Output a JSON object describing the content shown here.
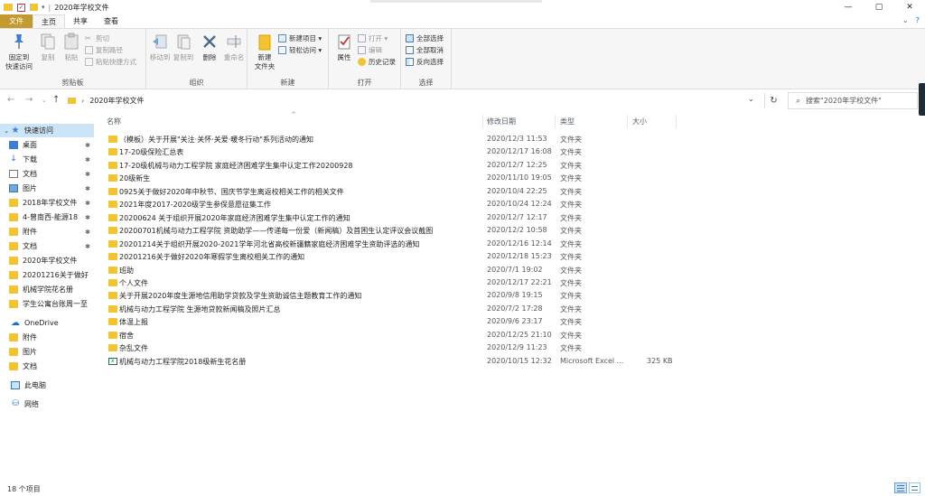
{
  "window": {
    "title": "2020年学校文件",
    "controls": {
      "minimize": "—",
      "maximize": "▢",
      "close": "✕"
    }
  },
  "ribbon_tabs": [
    "文件",
    "主页",
    "共享",
    "查看"
  ],
  "ribbon": {
    "clipboard": {
      "label": "剪贴板",
      "pin_quick_access": "固定到\n快速访问",
      "copy": "复制",
      "paste": "粘贴",
      "cut": "剪切",
      "copy_path": "复制路径",
      "paste_shortcut": "粘贴快捷方式"
    },
    "organize": {
      "label": "组织",
      "move_to": "移动到",
      "copy_to": "复制到",
      "delete": "删除",
      "rename": "重命名"
    },
    "new": {
      "label": "新建",
      "new_folder": "新建\n文件夹",
      "new_item": "新建项目 ▾",
      "easy_access": "轻松访问 ▾"
    },
    "open": {
      "label": "打开",
      "properties": "属性",
      "open": "打开 ▾",
      "edit": "编辑",
      "history": "历史记录"
    },
    "select": {
      "label": "选择",
      "select_all": "全部选择",
      "select_none": "全部取消",
      "invert": "反向选择"
    }
  },
  "address": {
    "path": "2020年学校文件",
    "search_placeholder": "搜索\"2020年学校文件\""
  },
  "columns": {
    "name": "名称",
    "date": "修改日期",
    "type": "类型",
    "size": "大小"
  },
  "sidebar": {
    "quick_access": "快速访问",
    "items": [
      {
        "label": "桌面",
        "icon": "desktop-icon",
        "pinned": true
      },
      {
        "label": "下载",
        "icon": "download-icon",
        "pinned": true
      },
      {
        "label": "文档",
        "icon": "documents-icon",
        "pinned": true
      },
      {
        "label": "图片",
        "icon": "pictures-icon",
        "pinned": true
      },
      {
        "label": "2018年学校文件",
        "icon": "folder-icon",
        "pinned": true
      },
      {
        "label": "4-曾南西-能源18",
        "icon": "folder-icon",
        "pinned": true
      },
      {
        "label": "附件",
        "icon": "folder-icon",
        "pinned": true
      },
      {
        "label": "文档",
        "icon": "folder-icon",
        "pinned": true
      },
      {
        "label": "2020年学校文件",
        "icon": "folder-icon",
        "pinned": false
      },
      {
        "label": "20201216关于做好",
        "icon": "folder-icon",
        "pinned": false
      },
      {
        "label": "机械学院花名册",
        "icon": "folder-icon",
        "pinned": false
      },
      {
        "label": "学生公寓台账周一至",
        "icon": "folder-icon",
        "pinned": false
      }
    ],
    "onedrive": "OneDrive",
    "onedrive_items": [
      "附件",
      "图片",
      "文档"
    ],
    "this_pc": "此电脑",
    "network": "网络"
  },
  "files": [
    {
      "name": "（模板）关于开展\"关注·关怀·关爱·暖冬行动\"系列活动的通知",
      "date": "2020/12/3 11:53",
      "type": "文件夹",
      "size": ""
    },
    {
      "name": "17-20级保险汇总表",
      "date": "2020/12/17 16:08",
      "type": "文件夹",
      "size": ""
    },
    {
      "name": "17-20级机械与动力工程学院 家庭经济困难学生集中认定工作20200928",
      "date": "2020/12/7 12:25",
      "type": "文件夹",
      "size": ""
    },
    {
      "name": "20级新生",
      "date": "2020/11/10 19:05",
      "type": "文件夹",
      "size": ""
    },
    {
      "name": "0925关于做好2020年中秋节、国庆节学生离返校相关工作的相关文件",
      "date": "2020/10/4 22:25",
      "type": "文件夹",
      "size": ""
    },
    {
      "name": "2021年度2017-2020级学生参保意愿征集工作",
      "date": "2020/10/24 12:24",
      "type": "文件夹",
      "size": ""
    },
    {
      "name": "20200624 关于组织开展2020年家庭经济困难学生集中认定工作的通知",
      "date": "2020/12/7 12:17",
      "type": "文件夹",
      "size": ""
    },
    {
      "name": "20200701机械与动力工程学院 资助助学——传递每一份爱（新闻稿）及首困生认定评议会议截图",
      "date": "2020/12/2 10:58",
      "type": "文件夹",
      "size": ""
    },
    {
      "name": "20201214关于组织开展2020-2021学年河北省高校新疆籍家庭经济困难学生资助评选的通知",
      "date": "2020/12/16 12:14",
      "type": "文件夹",
      "size": ""
    },
    {
      "name": "20201216关于做好2020年寒假学生离校相关工作的通知",
      "date": "2020/12/18 15:23",
      "type": "文件夹",
      "size": ""
    },
    {
      "name": "班助",
      "date": "2020/7/1 19:02",
      "type": "文件夹",
      "size": ""
    },
    {
      "name": "个人文件",
      "date": "2020/12/17 22:21",
      "type": "文件夹",
      "size": ""
    },
    {
      "name": "关于开展2020年度生源地信用助学贷款及学生资助诚信主题教育工作的通知",
      "date": "2020/9/8 19:15",
      "type": "文件夹",
      "size": ""
    },
    {
      "name": "机械与动力工程学院 生源地贷款新闻稿及照片汇总",
      "date": "2020/7/2 17:28",
      "type": "文件夹",
      "size": ""
    },
    {
      "name": "体温上报",
      "date": "2020/9/6 23:17",
      "type": "文件夹",
      "size": ""
    },
    {
      "name": "宿舍",
      "date": "2020/12/25 21:10",
      "type": "文件夹",
      "size": ""
    },
    {
      "name": "杂乱文件",
      "date": "2020/12/9 11:23",
      "type": "文件夹",
      "size": ""
    },
    {
      "name": "机械与动力工程学院2018级新生花名册",
      "date": "2020/10/15 12:32",
      "type": "Microsoft Excel ...",
      "size": "325 KB",
      "icon": "excel-icon"
    }
  ],
  "status": {
    "count": "18 个项目"
  },
  "colors": {
    "file_tab": "#c39a2f",
    "folder": "#f4c430",
    "selected": "#cce4f7",
    "accent": "#3a7fd5"
  }
}
